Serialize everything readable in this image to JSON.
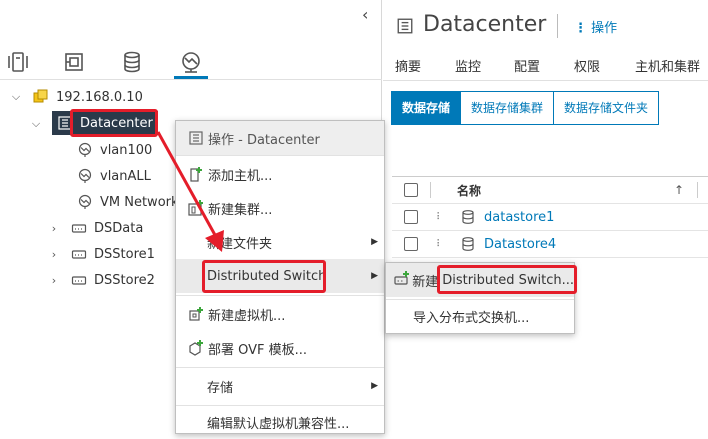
{
  "navigator": {
    "tabs": [
      "hosts-clusters",
      "vms-templates",
      "storage",
      "networking"
    ],
    "tree": {
      "root": {
        "label": "192.168.0.10",
        "expanded": true
      },
      "datacenter": {
        "label": "Datacenter",
        "expanded": true,
        "selected": true
      },
      "children": [
        {
          "label": "vlan100",
          "icon": "network-icon",
          "expandable": false
        },
        {
          "label": "vlanALL",
          "icon": "network-icon",
          "expandable": false
        },
        {
          "label": "VM Network",
          "icon": "network-icon",
          "expandable": false
        },
        {
          "label": "DSData",
          "icon": "dvswitch-icon",
          "expandable": true
        },
        {
          "label": "DSStore1",
          "icon": "dvswitch-icon",
          "expandable": true
        },
        {
          "label": "DSStore2",
          "icon": "dvswitch-icon",
          "expandable": true
        }
      ]
    }
  },
  "header": {
    "title": "Datacenter",
    "actions_label": "操作"
  },
  "main_tabs": [
    "摘要",
    "监控",
    "配置",
    "权限",
    "主机和集群"
  ],
  "sub_tabs": [
    {
      "label": "数据存储",
      "active": true
    },
    {
      "label": "数据存储集群",
      "active": false
    },
    {
      "label": "数据存储文件夹",
      "active": false
    }
  ],
  "grid": {
    "column_name": "名称",
    "sort_icon": "sort-ascending-icon",
    "rows": [
      {
        "name": "datastore1"
      },
      {
        "name": "Datastore4"
      }
    ]
  },
  "context_menu": {
    "header": "操作 - Datacenter",
    "items": [
      {
        "label": "添加主机...",
        "icon": "add-host-icon",
        "submenu": false
      },
      {
        "label": "新建集群...",
        "icon": "new-cluster-icon",
        "submenu": false
      },
      {
        "label": "新建文件夹",
        "icon": "",
        "submenu": true
      },
      {
        "label": "Distributed Switch",
        "icon": "",
        "submenu": true,
        "highlighted": true
      },
      {
        "label": "新建虚拟机...",
        "icon": "new-vm-icon",
        "submenu": false
      },
      {
        "label": "部署 OVF 模板...",
        "icon": "deploy-ovf-icon",
        "submenu": false
      },
      {
        "label": "存储",
        "icon": "",
        "submenu": true
      },
      {
        "label": "编辑默认虚拟机兼容性...",
        "icon": "",
        "submenu": false
      }
    ]
  },
  "submenu": {
    "items": [
      {
        "prefix": "新建",
        "label": "Distributed Switch...",
        "icon": "new-dvswitch-icon",
        "highlighted": true
      },
      {
        "label": "导入分布式交换机...",
        "icon": ""
      }
    ]
  },
  "colors": {
    "accent": "#0079b8",
    "selected_row": "#2b3a4a",
    "annotation_red": "#e41d2a",
    "add_green": "#3ca63c"
  }
}
